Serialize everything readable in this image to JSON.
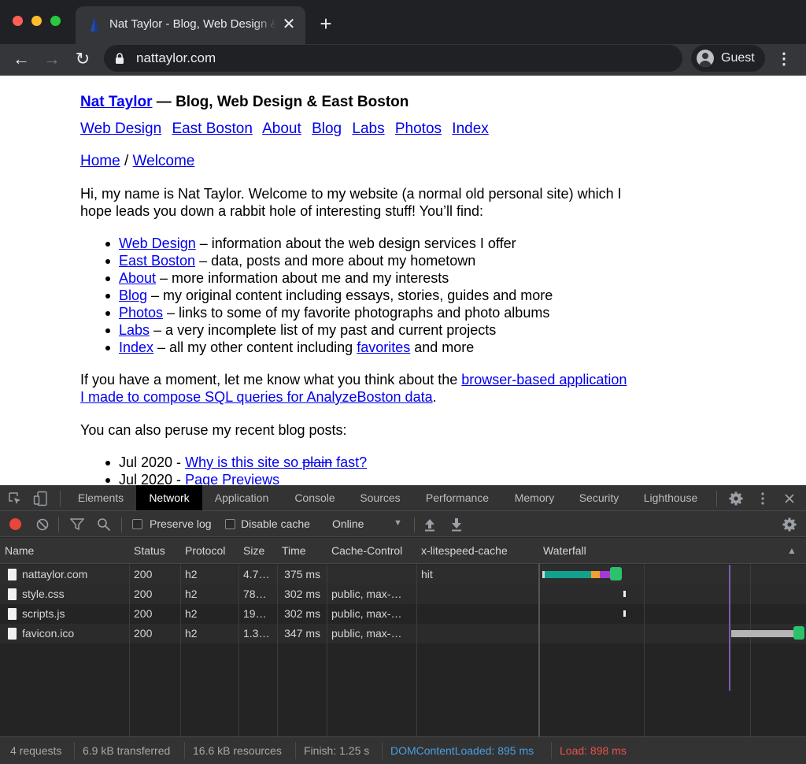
{
  "browser": {
    "tab_title": "Nat Taylor - Blog, Web Design & East Boston",
    "tab_close": "✕",
    "new_tab": "+",
    "url": "nattaylor.com",
    "profile_label": "Guest",
    "icons": {
      "back": "←",
      "forward": "→",
      "reload": "↻",
      "menu": "⋮"
    }
  },
  "site": {
    "home_link": "Nat Taylor",
    "tagline": " — Blog, Web Design & East Boston",
    "nav": [
      "Web Design",
      "East Boston",
      "About",
      "Blog",
      "Labs",
      "Photos",
      "Index"
    ],
    "breadcrumb": {
      "home": "Home",
      "sep": " / ",
      "current": "Welcome"
    },
    "intro": "Hi, my name is Nat Taylor.  Welcome to my website (a normal old personal site) which I hope leads you down a rabbit hole of interesting stuff!  You’ll find:",
    "sections": [
      {
        "link": "Web Design",
        "text": " – information about the web design services I offer"
      },
      {
        "link": "East Boston",
        "text": " – data, posts and more about my hometown"
      },
      {
        "link": "About",
        "text": " – more information about me and my interests"
      },
      {
        "link": "Blog",
        "text": " – my original content including essays, stories, guides and more"
      },
      {
        "link": "Photos",
        "text": " – links to some of my favorite photographs and photo albums"
      },
      {
        "link": "Labs",
        "text": " – a very incomplete list of my past and current projects"
      },
      {
        "link": "Index",
        "text": " – all my other content including ",
        "link2": "favorites",
        "text2": " and more"
      }
    ],
    "feedback_before": "If you have a moment, let me know what you think about the ",
    "feedback_link": "browser-based application I made to compose SQL queries for AnalyzeBoston data",
    "feedback_after": ".",
    "recent_intro": "You can also peruse my recent blog posts:",
    "recent_posts": [
      {
        "date": "Jul 2020 - ",
        "title_a": "Why is this site so ",
        "title_strike": "plain",
        "title_b": " fast?"
      },
      {
        "date": "Jul 2020 - ",
        "title": "Page Previews"
      }
    ]
  },
  "devtools": {
    "tabs": [
      "Elements",
      "Network",
      "Application",
      "Console",
      "Sources",
      "Performance",
      "Memory",
      "Security",
      "Lighthouse"
    ],
    "active_tab": "Network",
    "preserve_log": "Preserve log",
    "disable_cache": "Disable cache",
    "throttling": "Online",
    "columns": [
      "Name",
      "Status",
      "Protocol",
      "Size",
      "Time",
      "Cache-Control",
      "x-litespeed-cache",
      "Waterfall"
    ],
    "rows": [
      {
        "name": "nattaylor.com",
        "status": "200",
        "protocol": "h2",
        "size": "4.7…",
        "time": "375 ms",
        "cache_control": "",
        "litespeed": "hit"
      },
      {
        "name": "style.css",
        "status": "200",
        "protocol": "h2",
        "size": "78…",
        "time": "302 ms",
        "cache_control": "public, max-…",
        "litespeed": ""
      },
      {
        "name": "scripts.js",
        "status": "200",
        "protocol": "h2",
        "size": "19…",
        "time": "302 ms",
        "cache_control": "public, max-…",
        "litespeed": ""
      },
      {
        "name": "favicon.ico",
        "status": "200",
        "protocol": "h2",
        "size": "1.3…",
        "time": "347 ms",
        "cache_control": "public, max-…",
        "litespeed": ""
      }
    ],
    "status_bar": {
      "requests": "4 requests",
      "transferred": "6.9 kB transferred",
      "resources": "16.6 kB resources",
      "finish": "Finish: 1.25 s",
      "dom_content_loaded": "DOMContentLoaded: 895 ms",
      "load": "Load: 898 ms"
    },
    "colors": {
      "dcl": "#4b9fe3",
      "load": "#e8534a",
      "waterfall_waiting": "#12a18d",
      "waterfall_download": "#2bc26b",
      "waterfall_ssl": "#a33ad6",
      "waterfall_connect": "#f0a030",
      "dom_line": "#7b5ab7"
    }
  }
}
